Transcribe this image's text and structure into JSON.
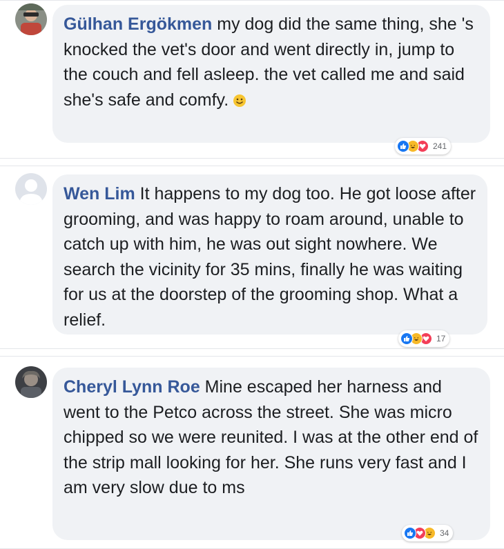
{
  "comments": [
    {
      "author": "Gülhan Ergökmen",
      "text": " my dog did the same thing, she 's knocked the vet's door and went directly in, jump to the couch and fell asleep. the vet called me and said she's safe and comfy.",
      "emoji": "smiley-emoji",
      "reactions": [
        "like",
        "haha",
        "love"
      ],
      "reaction_count": "241"
    },
    {
      "author": "Wen Lim",
      "text": " It happens to my dog too. He got loose after grooming, and was happy to roam around, unable to catch up with him, he was out sight nowhere. We search the vicinity for 35 mins, finally he was waiting for us at the doorstep of the grooming shop. What a relief.",
      "reactions": [
        "like",
        "haha",
        "love"
      ],
      "reaction_count": "17"
    },
    {
      "author": "Cheryl Lynn Roe",
      "text": " Mine escaped her harness and went to the Petco across the street. She was micro chipped so we were reunited. I was at the other end of the strip mall looking for her. She runs very fast and I am very slow due to ms",
      "reactions": [
        "like",
        "love",
        "haha"
      ],
      "reaction_count": "34"
    }
  ],
  "colors": {
    "author": "#365899",
    "bubble": "#f0f2f5",
    "like": "#1877f2",
    "haha": "#f7b928",
    "love": "#f33e58"
  }
}
